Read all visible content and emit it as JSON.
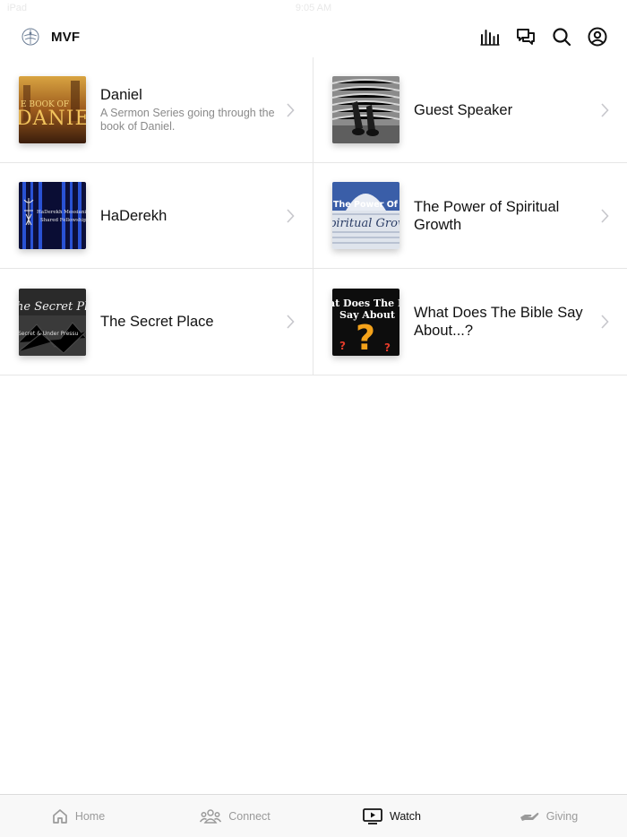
{
  "status": {
    "carrier": "iPad",
    "time": "9:05 AM"
  },
  "brand": {
    "name": "MVF"
  },
  "header_icons": [
    "audio-bars-icon",
    "chat-bubbles-icon",
    "search-icon",
    "account-icon"
  ],
  "series": [
    {
      "title": "Daniel",
      "subtitle": "A Sermon Series going through the book of Daniel.",
      "thumb_text": "THE BOOK OF DANIEL"
    },
    {
      "title": "Guest Speaker",
      "subtitle": "",
      "thumb_text": ""
    },
    {
      "title": "HaDerekh",
      "subtitle": "",
      "thumb_text": "HaDerekh Messianic Shared Fellowship"
    },
    {
      "title": "The Power of Spiritual Growth",
      "subtitle": "",
      "thumb_text": "The Power Of Spiritual Growth"
    },
    {
      "title": "The Secret Place",
      "subtitle": "",
      "thumb_text": "The Secret Place — Secret & Under Pressure"
    },
    {
      "title": "What Does The Bible Say About...?",
      "subtitle": "",
      "thumb_text": "What Does The Bible Say About"
    }
  ],
  "tabs": [
    {
      "label": "Home",
      "icon": "home-icon",
      "active": false
    },
    {
      "label": "Connect",
      "icon": "people-icon",
      "active": false
    },
    {
      "label": "Watch",
      "icon": "tv-play-icon",
      "active": true
    },
    {
      "label": "Giving",
      "icon": "giving-hand-icon",
      "active": false
    }
  ],
  "colors": {
    "text": "#111111",
    "muted": "#8a8a8a",
    "tab_inactive": "#9a9a9a",
    "divider": "#e6e6e6"
  }
}
